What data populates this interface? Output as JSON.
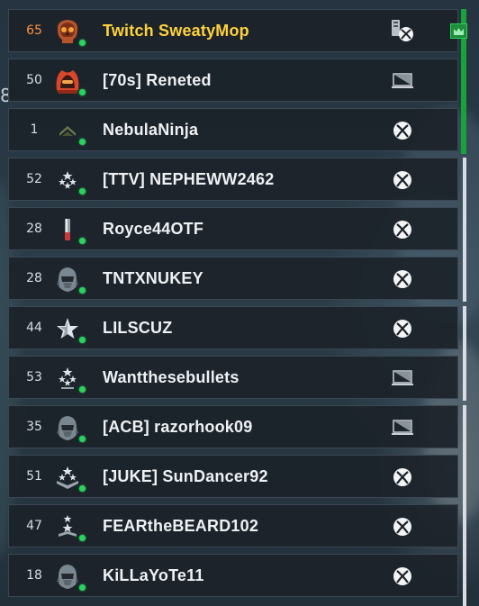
{
  "roster": [
    {
      "level": "65",
      "name": "Twitch SweatyMop",
      "emblem": "flaming-skull-emblem",
      "platform": "pc-xbox-icon",
      "highlight": true
    },
    {
      "level": "50",
      "name": "[70s] Reneted",
      "emblem": "spartan-fire-emblem",
      "platform": "pc-icon"
    },
    {
      "level": "1",
      "name": "NebulaNinja",
      "emblem": "chevron-rank-icon",
      "platform": "xbox-icon"
    },
    {
      "level": "52",
      "name": "[TTV] NEPHEWW2462",
      "emblem": "star-cluster-rank-icon",
      "platform": "xbox-icon"
    },
    {
      "level": "28",
      "name": "Royce44OTF",
      "emblem": "blade-emblem",
      "platform": "xbox-icon"
    },
    {
      "level": "28",
      "name": "TNTXNUKEY",
      "emblem": "spartan-helmet-emblem",
      "platform": "xbox-icon"
    },
    {
      "level": "44",
      "name": "LILSCUZ",
      "emblem": "star-rank-icon",
      "platform": "xbox-icon"
    },
    {
      "level": "53",
      "name": "Wantthesebullets",
      "emblem": "star-cluster-rank-icon",
      "platform": "pc-icon"
    },
    {
      "level": "35",
      "name": "[ACB] razorhook09",
      "emblem": "spartan-helmet-emblem",
      "platform": "pc-icon"
    },
    {
      "level": "51",
      "name": "[JUKE] SunDancer92",
      "emblem": "star-wings-rank-icon",
      "platform": "xbox-icon"
    },
    {
      "level": "47",
      "name": "FEARtheBEARD102",
      "emblem": "star-tower-rank-icon",
      "platform": "xbox-icon"
    },
    {
      "level": "18",
      "name": "KiLLaYoTe11",
      "emblem": "spartan-helmet-emblem",
      "platform": "xbox-icon"
    }
  ],
  "colors": {
    "online": "#2ad35d",
    "highlight_name": "#ffd23c",
    "highlight_level": "#ff9142",
    "team_bar": "#15a33a"
  },
  "leader_badge_icon": "crown-icon"
}
